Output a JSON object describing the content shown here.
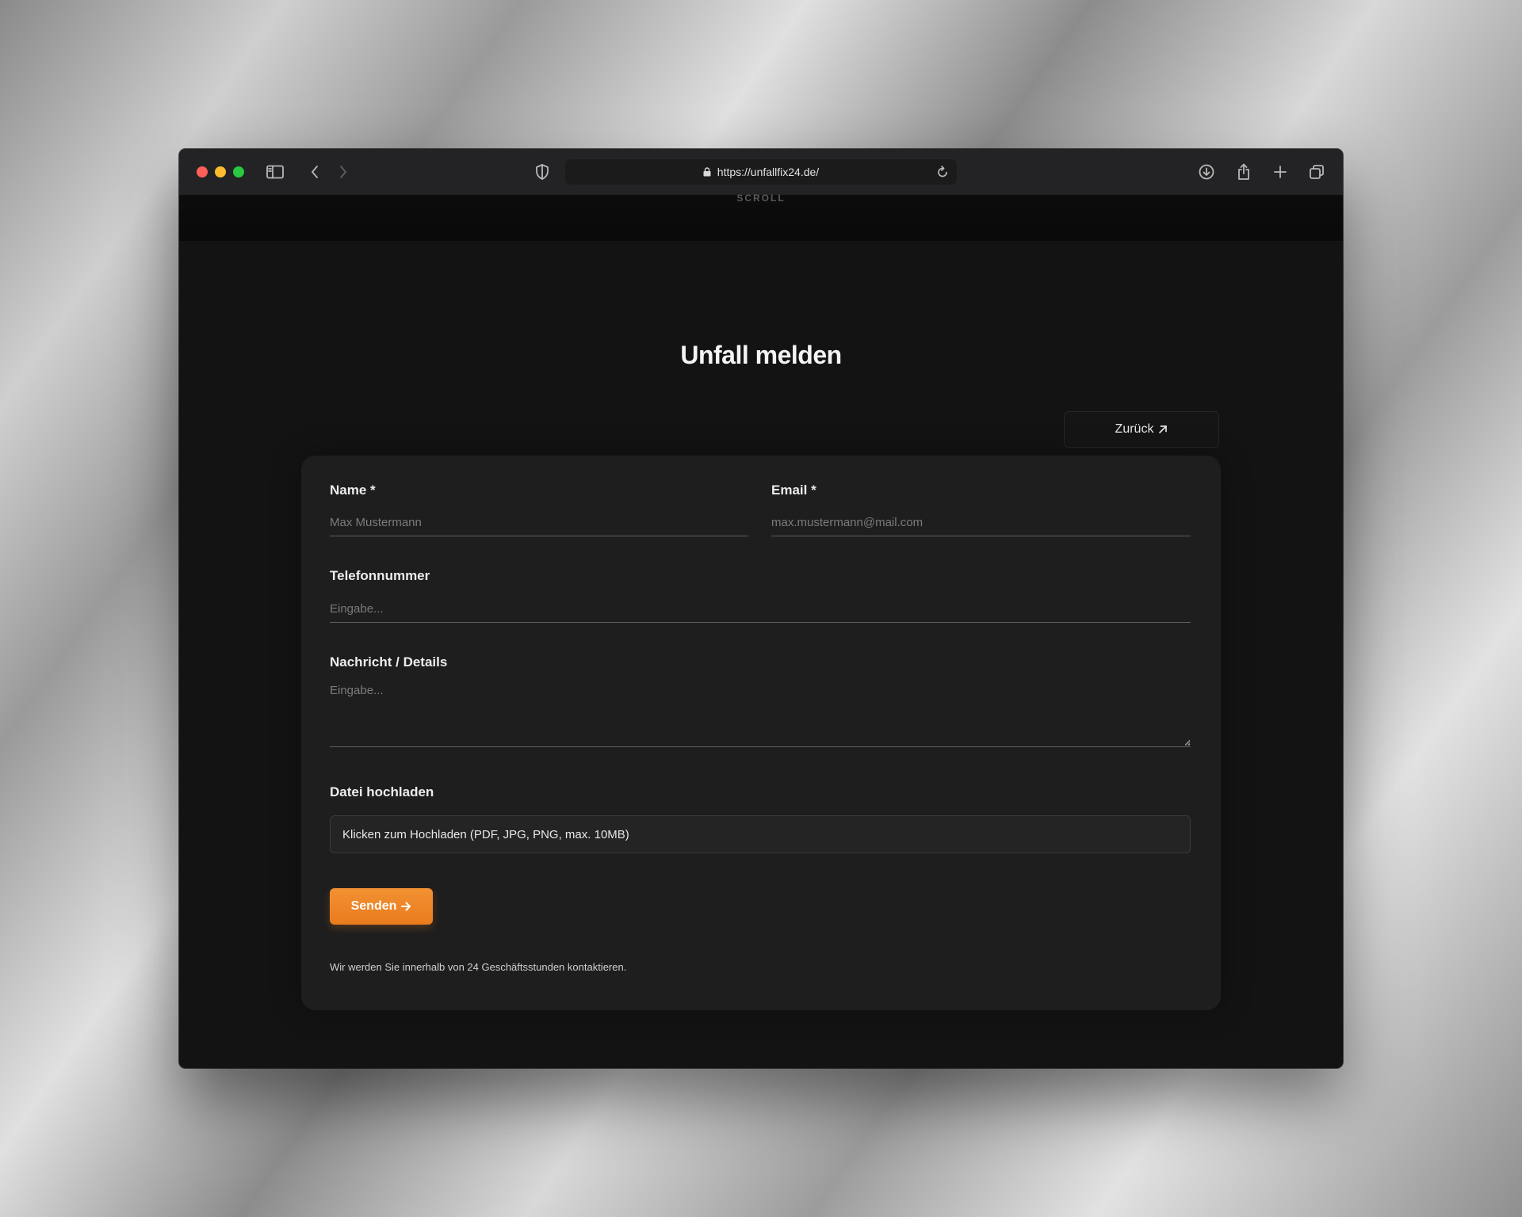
{
  "browser": {
    "url": "https://unfallfix24.de/"
  },
  "page": {
    "scroll_hint": "SCROLL",
    "title": "Unfall melden",
    "back_label": "Zurück",
    "form": {
      "name_label": "Name *",
      "name_placeholder": "Max Mustermann",
      "email_label": "Email *",
      "email_placeholder": "max.mustermann@mail.com",
      "phone_label": "Telefonnummer",
      "phone_placeholder": "Eingabe...",
      "message_label": "Nachricht / Details",
      "message_placeholder": "Eingabe...",
      "upload_label": "Datei hochladen",
      "upload_text": "Klicken zum Hochladen (PDF, JPG, PNG, max. 10MB)",
      "submit_label": "Senden",
      "note": "Wir werden Sie innerhalb von 24 Geschäftsstunden kontaktieren."
    }
  },
  "colors": {
    "accent": "#f0882a",
    "background": "#131313",
    "card": "#1e1e1e"
  }
}
